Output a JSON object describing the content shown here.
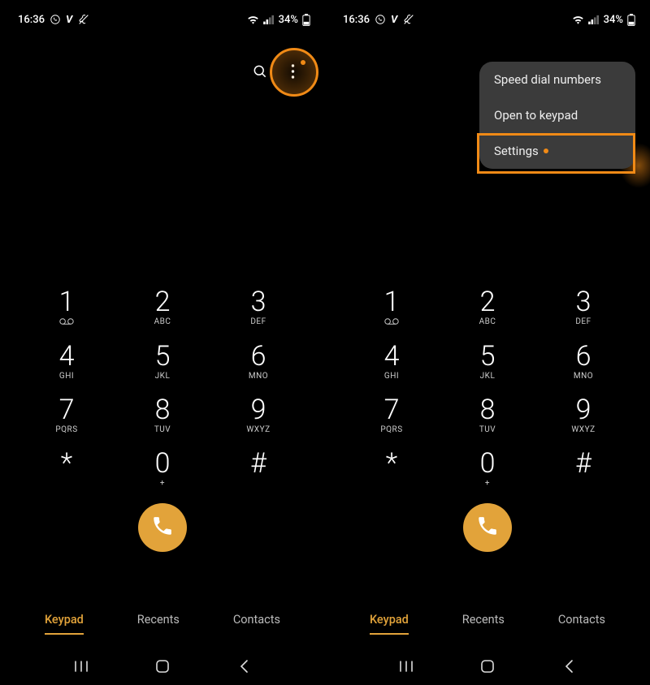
{
  "status": {
    "time": "16:36",
    "battery_text": "34%"
  },
  "menu": {
    "items": [
      {
        "label": "Speed dial numbers"
      },
      {
        "label": "Open to keypad"
      },
      {
        "label": "Settings"
      }
    ]
  },
  "keypad": {
    "rows": [
      [
        {
          "digit": "1",
          "sub": "vm"
        },
        {
          "digit": "2",
          "sub": "ABC"
        },
        {
          "digit": "3",
          "sub": "DEF"
        }
      ],
      [
        {
          "digit": "4",
          "sub": "GHI"
        },
        {
          "digit": "5",
          "sub": "JKL"
        },
        {
          "digit": "6",
          "sub": "MNO"
        }
      ],
      [
        {
          "digit": "7",
          "sub": "PQRS"
        },
        {
          "digit": "8",
          "sub": "TUV"
        },
        {
          "digit": "9",
          "sub": "WXYZ"
        }
      ],
      [
        {
          "digit": "*",
          "sub": ""
        },
        {
          "digit": "0",
          "sub": "+"
        },
        {
          "digit": "#",
          "sub": ""
        }
      ]
    ]
  },
  "tabs": {
    "items": [
      {
        "label": "Keypad",
        "active": true
      },
      {
        "label": "Recents",
        "active": false
      },
      {
        "label": "Contacts",
        "active": false
      }
    ]
  },
  "colors": {
    "accent": "#F08A16",
    "call": "#E2A33A"
  }
}
